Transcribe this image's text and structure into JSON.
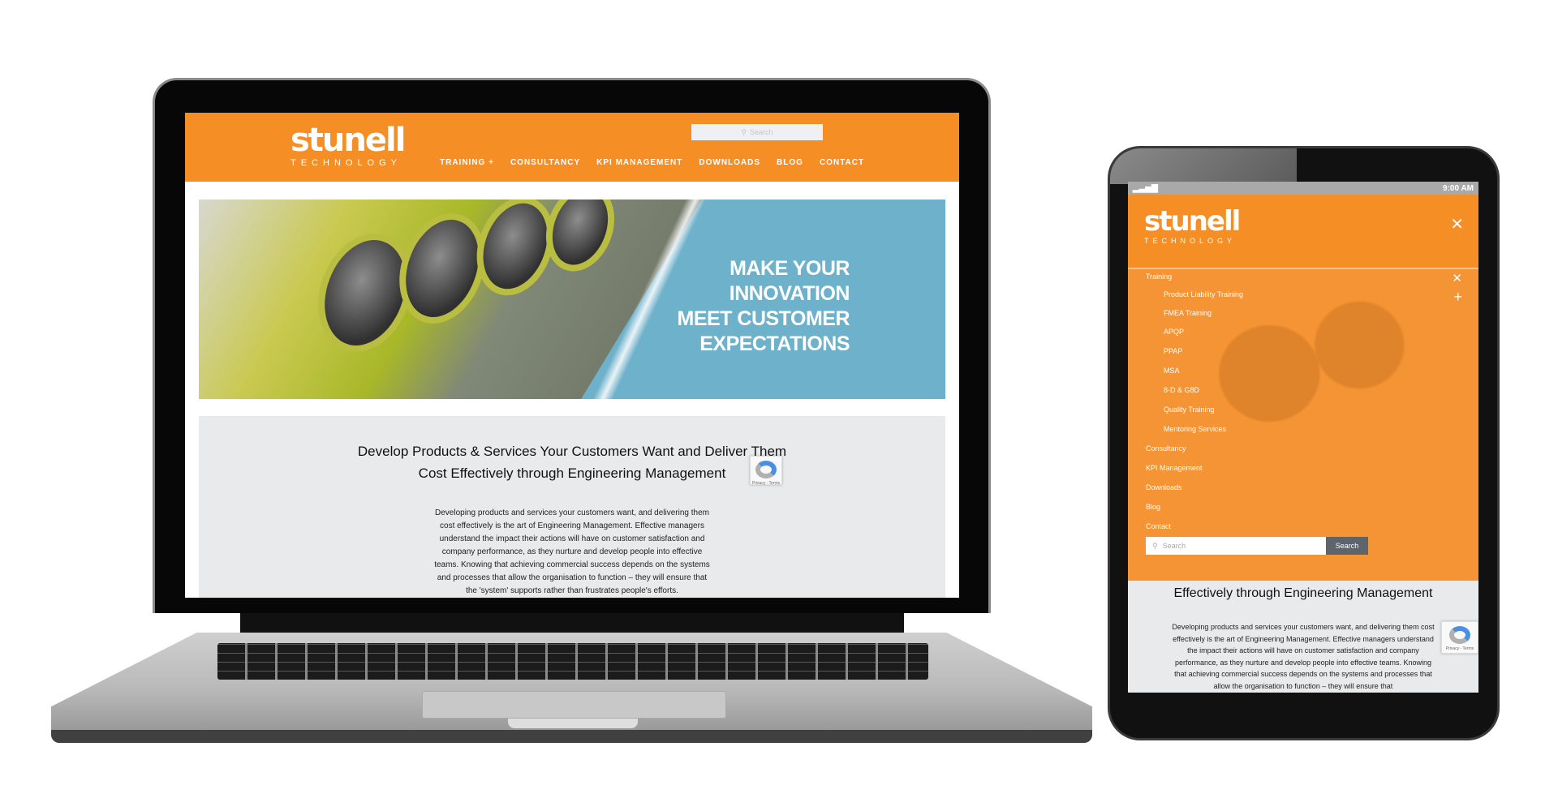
{
  "brand": {
    "name": "stunell",
    "tagline": "TECHNOLOGY",
    "accent_color": "#f68e26"
  },
  "desktop": {
    "search": {
      "icon": "search-icon",
      "placeholder": "Search"
    },
    "nav": [
      {
        "label": "TRAINING +"
      },
      {
        "label": "CONSULTANCY"
      },
      {
        "label": "KPI MANAGEMENT"
      },
      {
        "label": "DOWNLOADS"
      },
      {
        "label": "BLOG"
      },
      {
        "label": "CONTACT"
      }
    ],
    "hero": {
      "lines": [
        "MAKE YOUR",
        "INNOVATION",
        "MEET CUSTOMER",
        "EXPECTATIONS"
      ]
    },
    "intro": {
      "heading": "Develop Products & Services Your Customers Want and Deliver Them Cost Effectively through Engineering Management",
      "body": "Developing products and services your customers want, and delivering them cost effectively is the art of Engineering Management. Effective managers understand the impact their actions will have on customer satisfaction and company performance, as they nurture and develop people into effective teams. Knowing that achieving commercial success depends on the systems and processes that allow the organisation to function  – they will ensure that the 'system' supports rather than frustrates people's efforts."
    },
    "recaptcha": {
      "text": "Privacy - Terms"
    }
  },
  "tablet": {
    "status": {
      "signal_icon": "signal-bars-icon",
      "time": "9:00 AM"
    },
    "close_icon": "close-icon",
    "menu": {
      "training": {
        "label": "Training",
        "expanded": true
      },
      "training_items": [
        {
          "label": "Product Liability Training"
        },
        {
          "label": "FMEA Training"
        },
        {
          "label": "APQP"
        },
        {
          "label": "PPAP"
        },
        {
          "label": "MSA"
        },
        {
          "label": "8-D & G8D"
        },
        {
          "label": "Quality Training"
        },
        {
          "label": "Mentoring Services"
        }
      ],
      "top_items": [
        {
          "label": "Consultancy"
        },
        {
          "label": "KPI Management"
        },
        {
          "label": "Downloads"
        },
        {
          "label": "Blog"
        },
        {
          "label": "Contact"
        }
      ]
    },
    "search": {
      "placeholder": "Search",
      "button": "Search"
    },
    "intro": {
      "heading_visible": "Effectively through Engineering Management",
      "body": "Developing products and services your customers want, and delivering them cost effectively is the art of Engineering Management. Effective managers understand the impact their actions will have on customer satisfaction and company performance, as they nurture and develop people into effective teams. Knowing that achieving commercial success depends on the systems and processes that allow the organisation to function  – they will ensure that"
    },
    "recaptcha": {
      "text": "Privacy - Terms"
    }
  }
}
